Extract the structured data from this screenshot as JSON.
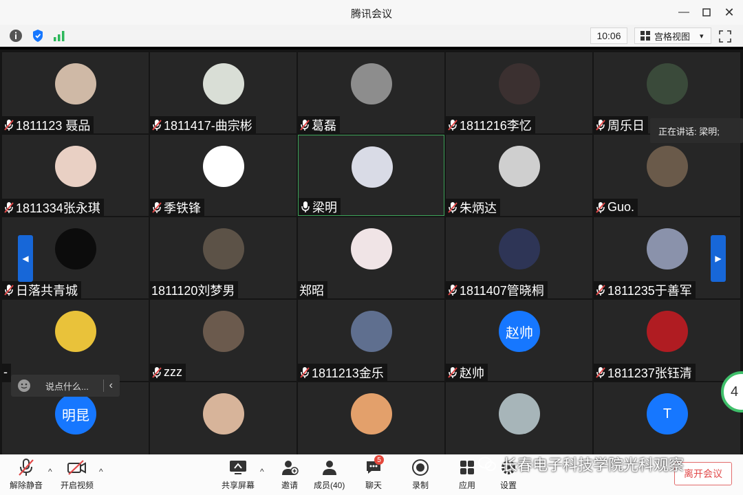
{
  "window": {
    "title": "腾讯会议",
    "min": "—",
    "max": "☐",
    "close": "✕"
  },
  "status": {
    "time": "10:06",
    "view_label": "宫格视图",
    "view_caret": "▾"
  },
  "participants": [
    {
      "name": "1811123 聂品",
      "muted": true,
      "bg": "#cfb9a6"
    },
    {
      "name": "1811417-曲宗彬",
      "muted": true,
      "bg": "#d9ded6"
    },
    {
      "name": "葛磊",
      "muted": true,
      "bg": "#8d8d8d"
    },
    {
      "name": "1811216李忆",
      "muted": true,
      "bg": "#3b3030"
    },
    {
      "name": "周乐日",
      "muted": true,
      "bg": "#3a4a3a"
    },
    {
      "name": "1811334张永琪",
      "muted": true,
      "bg": "#e9d0c4"
    },
    {
      "name": "季铁锋",
      "muted": true,
      "bg": "#ffffff"
    },
    {
      "name": "梁明",
      "muted": false,
      "bg": "#d9dbe6",
      "active": true
    },
    {
      "name": "朱炳达",
      "muted": true,
      "bg": "#cfcfcf"
    },
    {
      "name": "Guo.",
      "muted": true,
      "bg": "#6a5a4a"
    },
    {
      "name": "日落共青城",
      "muted": true,
      "bg": "#0c0c0c"
    },
    {
      "name": "1811120刘梦男",
      "muted": false,
      "bg": "#5c5247"
    },
    {
      "name": "郑昭",
      "muted": false,
      "bg": "#f0e4e6"
    },
    {
      "name": "1811407管晓桐",
      "muted": true,
      "bg": "#2e3556"
    },
    {
      "name": "1811235于善军",
      "muted": true,
      "bg": "#8a92ab"
    },
    {
      "name": "-",
      "muted": false,
      "bg": "#e9c23a"
    },
    {
      "name": "zzz",
      "muted": true,
      "bg": "#6b5a4d"
    },
    {
      "name": "1811213金乐",
      "muted": true,
      "bg": "#5f6f8f"
    },
    {
      "name": "赵帅",
      "muted": true,
      "bg": "#1677ff",
      "initials": "赵帅"
    },
    {
      "name": "1811237张钰清",
      "muted": true,
      "bg": "#b01c22"
    },
    {
      "name": "",
      "muted": false,
      "bg": "#1677ff",
      "initials": "明昆"
    },
    {
      "name": "",
      "muted": false,
      "bg": "#d7b49a"
    },
    {
      "name": "",
      "muted": false,
      "bg": "#e3a06b"
    },
    {
      "name": "",
      "muted": false,
      "bg": "#a7b5b9"
    },
    {
      "name": "",
      "muted": false,
      "bg": "#1677ff",
      "initials": "T"
    }
  ],
  "speaking": "正在讲话: 梁明;",
  "chat": {
    "placeholder": "说点什么...",
    "collapse": "‹"
  },
  "gauge": "4",
  "toolbar": {
    "unmute": "解除静音",
    "video": "开启视频",
    "share": "共享屏幕",
    "invite": "邀请",
    "members": "成员(40)",
    "chat": "聊天",
    "chat_badge": "5",
    "record": "录制",
    "apps": "应用",
    "settings": "设置",
    "leave": "离开会议",
    "caret": "^"
  },
  "watermark": "长春电子科技学院光科观察",
  "nav": {
    "prev": "◀",
    "next": "▶"
  },
  "colors": {
    "accent": "#1677ff",
    "leave": "#e14848",
    "active_border": "#3ea55a"
  }
}
